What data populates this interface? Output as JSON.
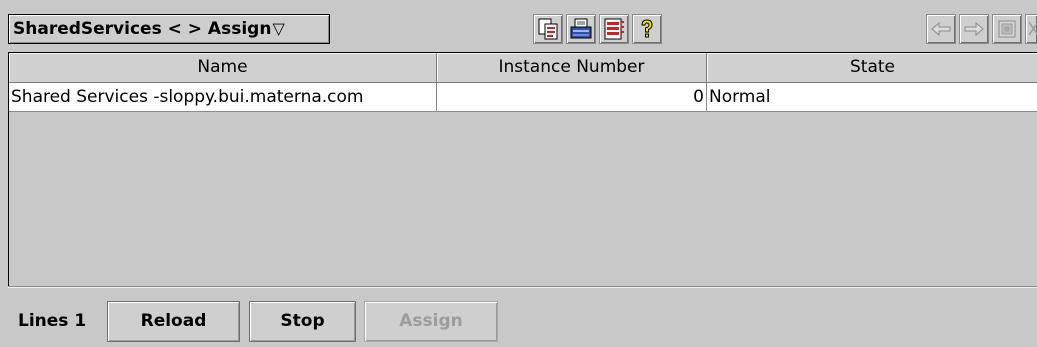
{
  "toolbar": {
    "title": "SharedServices < > Assign",
    "caret": "▽",
    "icons": [
      "copy-document-icon",
      "print-icon",
      "table-list-icon",
      "help-icon"
    ],
    "nav_icons": [
      "back-arrow-icon",
      "forward-arrow-icon",
      "refresh-icon",
      "close-icon"
    ]
  },
  "table": {
    "columns": [
      "Name",
      "Instance Number",
      "State"
    ],
    "rows": [
      {
        "name": "Shared Services -sloppy.bui.materna.com",
        "instance": "0",
        "state": "Normal"
      }
    ]
  },
  "footer": {
    "lines_label": "Lines 1",
    "reload": "Reload",
    "stop": "Stop",
    "assign": "Assign"
  },
  "colors": {
    "background": "#c8c8c8",
    "row_background": "#ffffff",
    "disabled_text": "#9c9c9c",
    "help_icon": "#f5e600",
    "icon_red": "#d02020"
  }
}
